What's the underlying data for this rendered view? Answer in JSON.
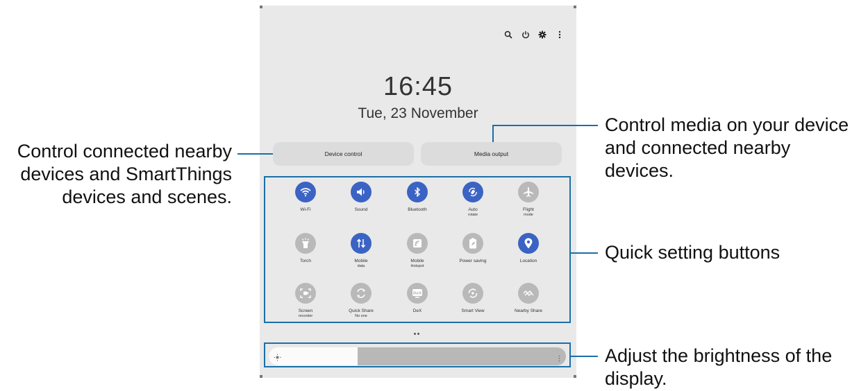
{
  "status_icons": [
    "search-icon",
    "power-icon",
    "gear-icon",
    "more-vert-icon"
  ],
  "clock": {
    "time": "16:45",
    "date": "Tue, 23 November"
  },
  "buttons": {
    "device_control": "Device control",
    "media_output": "Media output"
  },
  "quick_settings": [
    {
      "label": "Wi-Fi",
      "sub": "",
      "icon": "wifi-icon",
      "on": true
    },
    {
      "label": "Sound",
      "sub": "",
      "icon": "sound-icon",
      "on": true
    },
    {
      "label": "Bluetooth",
      "sub": "",
      "icon": "bluetooth-icon",
      "on": true
    },
    {
      "label": "Auto",
      "sub": "rotate",
      "icon": "auto-rotate-icon",
      "on": true
    },
    {
      "label": "Flight",
      "sub": "mode",
      "icon": "airplane-icon",
      "on": false
    },
    {
      "label": "Torch",
      "sub": "",
      "icon": "torch-icon",
      "on": false
    },
    {
      "label": "Mobile",
      "sub": "data",
      "icon": "mobile-data-icon",
      "on": true
    },
    {
      "label": "Mobile",
      "sub": "Hotspot",
      "icon": "hotspot-icon",
      "on": false
    },
    {
      "label": "Power saving",
      "sub": "",
      "icon": "power-saving-icon",
      "on": false
    },
    {
      "label": "Location",
      "sub": "",
      "icon": "location-icon",
      "on": true
    },
    {
      "label": "Screen",
      "sub": "recorder",
      "icon": "screen-recorder-icon",
      "on": false
    },
    {
      "label": "Quick Share",
      "sub": "No one",
      "icon": "quick-share-icon",
      "on": false
    },
    {
      "label": "DeX",
      "sub": "",
      "icon": "dex-icon",
      "on": false
    },
    {
      "label": "Smart View",
      "sub": "",
      "icon": "smart-view-icon",
      "on": false
    },
    {
      "label": "Nearby Share",
      "sub": "",
      "icon": "nearby-share-icon",
      "on": false
    }
  ],
  "page_dots": 2,
  "brightness": {
    "level_percent": 30
  },
  "callouts": {
    "left": [
      "Control connected nearby",
      "devices and SmartThings",
      "devices and scenes."
    ],
    "right_top": [
      "Control media on your device",
      "and connected nearby",
      "devices."
    ],
    "right_mid": [
      "Quick setting buttons"
    ],
    "right_bottom": [
      "Adjust the brightness of the",
      "display."
    ]
  },
  "colors": {
    "accent": "#3b63c4",
    "callout_line": "#1a6fa8",
    "panel": "#e9e9e9"
  }
}
